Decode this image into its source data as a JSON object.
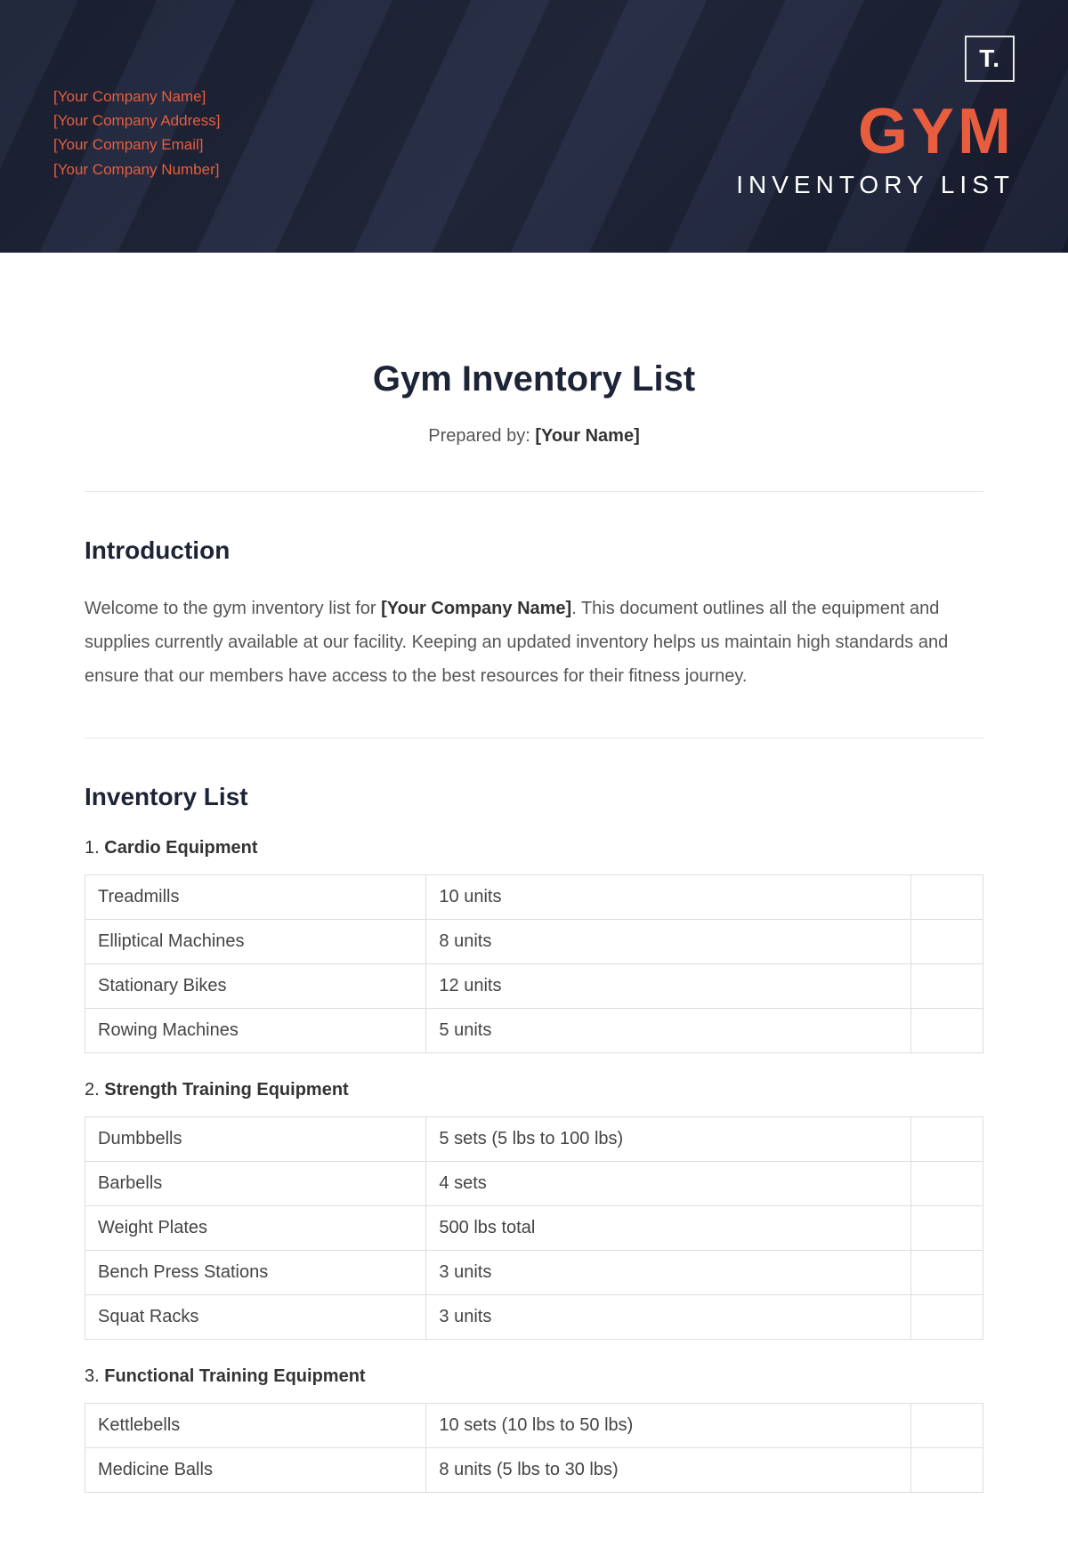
{
  "header": {
    "company_name": "[Your Company Name]",
    "company_address": "[Your Company Address]",
    "company_email": "[Your Company Email]",
    "company_number": "[Your Company Number]",
    "logo_text": "T.",
    "title_main": "GYM",
    "title_sub": "INVENTORY LIST"
  },
  "document": {
    "title": "Gym Inventory List",
    "prepared_label": "Prepared by: ",
    "prepared_value": "[Your Name]"
  },
  "introduction": {
    "heading": "Introduction",
    "text_before": "Welcome to the gym inventory list for ",
    "company_placeholder": "[Your Company Name]",
    "text_after": ". This document outlines all the equipment and supplies currently available at our facility. Keeping an updated inventory helps us maintain high standards and ensure that our members have access to the best resources for their fitness journey."
  },
  "inventory": {
    "heading": "Inventory List",
    "categories": [
      {
        "num": "1.",
        "name": "Cardio Equipment",
        "rows": [
          {
            "item": "Treadmills",
            "qty": "10 units"
          },
          {
            "item": "Elliptical Machines",
            "qty": "8 units"
          },
          {
            "item": "Stationary Bikes",
            "qty": "12 units"
          },
          {
            "item": "Rowing Machines",
            "qty": "5 units"
          }
        ]
      },
      {
        "num": "2.",
        "name": "Strength Training Equipment",
        "rows": [
          {
            "item": "Dumbbells",
            "qty": "5 sets (5 lbs to 100 lbs)"
          },
          {
            "item": "Barbells",
            "qty": "4 sets"
          },
          {
            "item": "Weight Plates",
            "qty": "500 lbs total"
          },
          {
            "item": "Bench Press Stations",
            "qty": "3 units"
          },
          {
            "item": "Squat Racks",
            "qty": "3 units"
          }
        ]
      },
      {
        "num": "3.",
        "name": "Functional Training Equipment",
        "rows": [
          {
            "item": "Kettlebells",
            "qty": "10 sets (10 lbs to 50 lbs)"
          },
          {
            "item": "Medicine Balls",
            "qty": "8 units (5 lbs to 30 lbs)"
          }
        ]
      }
    ]
  }
}
